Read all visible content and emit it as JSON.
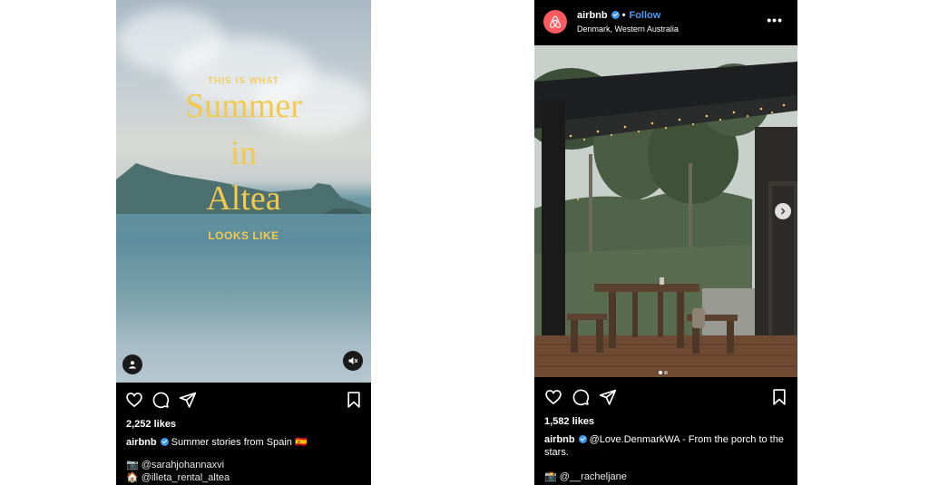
{
  "left_post": {
    "story": {
      "line1": "THIS IS WHAT",
      "line2": "Summer",
      "line3": "in",
      "line4": "Altea",
      "line5": "LOOKS LIKE"
    },
    "likes": "2,252 likes",
    "caption_user": "airbnb",
    "caption_text": "Summer stories from Spain 🇪🇸",
    "credit1": "📷 @sarahjohannaxvi",
    "credit2": "🏠 @illeta_rental_altea",
    "icons": [
      "heart-icon",
      "comment-icon",
      "share-icon",
      "bookmark-icon",
      "user-tag-icon",
      "mute-icon"
    ]
  },
  "right_post": {
    "handle": "airbnb",
    "follow_label": "Follow",
    "location": "Denmark, Western Australia",
    "more_label": "•••",
    "likes": "1,582 likes",
    "caption_user": "airbnb",
    "caption_text": "@Love.DenmarkWA - From the porch to the stars.",
    "credit": "📸 @__racheljane",
    "carousel_pages": 2,
    "carousel_current": 1,
    "icons": [
      "heart-icon",
      "comment-icon",
      "share-icon",
      "bookmark-icon",
      "chevron-right-icon"
    ]
  },
  "colors": {
    "story_text": "#f2c94c",
    "airbnb_brand": "#ff5a5f",
    "follow_blue": "#4a9cf5",
    "verified_blue": "#3897f0"
  }
}
